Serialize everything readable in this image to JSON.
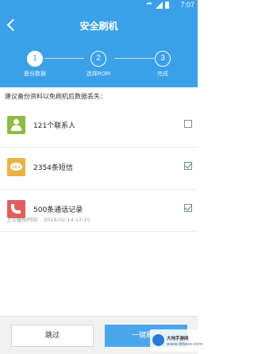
{
  "status_bar": {
    "time": "7:07"
  },
  "header": {
    "title": "安全刷机"
  },
  "steps": [
    {
      "number": "1",
      "label": "备份数据"
    },
    {
      "number": "2",
      "label": "选择ROM"
    },
    {
      "number": "3",
      "label": "完成"
    }
  ],
  "subtitle": "建议备份资料以免刷机后数据丢失：",
  "items": [
    {
      "label": "121个联系人",
      "checked": false,
      "icon": "contact-icon",
      "color": "#8dbb45"
    },
    {
      "label": "2354条短信",
      "checked": true,
      "icon": "sms-icon",
      "color": "#e8b244"
    },
    {
      "label": "500条通话记录",
      "checked": true,
      "icon": "phone-icon",
      "color": "#e35e5e"
    }
  ],
  "backup_time": {
    "label": "上次备份时间",
    "value": "2014-02-14 13:15"
  },
  "buttons": {
    "skip": "跳过",
    "flash": "一键刷机"
  },
  "watermark": {
    "title": "大地手游网",
    "subtitle": "www.ddooo.com"
  },
  "colors": {
    "accent": "#3aa0e8",
    "check": "#2b9b6a"
  }
}
